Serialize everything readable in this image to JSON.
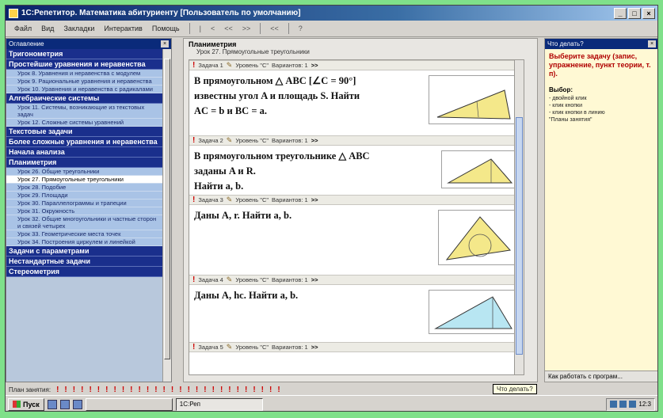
{
  "window": {
    "title": "1С:Репетитор. Математика абитуриенту [Пользователь по умолчанию]",
    "controls": [
      "_",
      "□",
      "×"
    ]
  },
  "menubar": {
    "items": [
      "Файл",
      "Вид",
      "Закладки",
      "Интерактив",
      "Помощь"
    ],
    "toolbar": [
      "|",
      "<",
      "<<",
      ">>",
      "|",
      "<<",
      "|",
      "?"
    ]
  },
  "left_panel": {
    "header": "Оглавление",
    "sections": [
      {
        "title": "Тригонометрия",
        "items": []
      },
      {
        "title": "Простейшие уравнения и неравенства",
        "items": [
          "Урок 8. Уравнения и неравенства с модулем",
          "Урок 9. Рациональные уравнения и неравенства",
          "Урок 10. Уравнения и неравенства с радикалами"
        ]
      },
      {
        "title": "Алгебраические системы",
        "items": [
          "Урок 11. Системы, возникающие из текстовых задач",
          "Урок 12. Сложные системы уравнений"
        ]
      },
      {
        "title": "Текстовые задачи",
        "items": []
      },
      {
        "title": "Более сложные уравнения и неравенства",
        "items": []
      },
      {
        "title": "Начала анализа",
        "items": []
      },
      {
        "title": "Планиметрия",
        "items": [
          "Урок 26. Общие треугольники",
          "Урок 27. Прямоугольные треугольники",
          "Урок 28. Подобие",
          "Урок 29. Площади",
          "Урок 30. Параллелограммы и трапеции",
          "Урок 31. Окружность",
          "Урок 32. Общие многоугольники и частные сторон и связей четырех",
          "Урок 33. Геометрические места точек",
          "Урок 34. Построения циркулем и линейкой"
        ]
      },
      {
        "title": "Задачи с параметрами",
        "items": []
      },
      {
        "title": "Нестандартные задачи",
        "items": []
      },
      {
        "title": "Стереометрия",
        "items": []
      }
    ],
    "active_item": "Урок 27. Прямоугольные треугольники"
  },
  "center": {
    "breadcrumb_section": "Планиметрия",
    "breadcrumb_lesson": "Урок 27. Прямоугольные треугольники",
    "tasks": [
      {
        "label": "Задача 1",
        "level": "Уровень \"C\"",
        "variants": "Вариантов: 1",
        "arrows": ">>",
        "text": [
          "В прямоугольном △ ABC [∠C = 90°]",
          "известны угол A и площадь S. Найти",
          "AC = b и BC = a."
        ]
      },
      {
        "label": "Задача 2",
        "level": "Уровень \"C\"",
        "variants": "Вариантов: 1",
        "arrows": ">>",
        "text": [
          "В прямоугольном треугольнике △ ABC",
          "заданы A и R.",
          "Найти a, b."
        ]
      },
      {
        "label": "Задача 3",
        "level": "Уровень \"C\"",
        "variants": "Вариантов: 1",
        "arrows": ">>",
        "text": [
          "Даны A, r. Найти a, b."
        ]
      },
      {
        "label": "Задача 4",
        "level": "Уровень \"C\"",
        "variants": "Вариантов: 1",
        "arrows": ">>",
        "text": [
          "Даны A, hc. Найти a, b."
        ]
      },
      {
        "label": "Задача 5",
        "level": "Уровень \"C\"",
        "variants": "Вариантов: 1",
        "arrows": ">>",
        "text": []
      }
    ]
  },
  "right_panel": {
    "header": "Что делать?",
    "hint": "Выберите задачу (запис, упражнение, пункт теории, т. п).",
    "choice_title": "Выбор:",
    "choice_list": [
      "- двойной клик",
      "- клик кнопки",
      "- клик кнопки в линию",
      "\"Планы занятия\""
    ],
    "footer": "Как работать с програм..."
  },
  "plan_bar": {
    "label": "План занятия:",
    "marks_count": 28,
    "tooltip": "Что делать?"
  },
  "taskbar": {
    "start": "Пуск",
    "tasks": [
      "",
      "1С:Реп"
    ],
    "clock": "12:3"
  },
  "colors": {
    "title_blue": "#0a246a",
    "section_blue": "#1a2f8c",
    "item_blue": "#a9c3e6",
    "hint_red": "#b00000",
    "figure_yellow": "#f4e88a",
    "figure_cyan": "#b8e6f2",
    "mark_red": "#cc0000"
  }
}
